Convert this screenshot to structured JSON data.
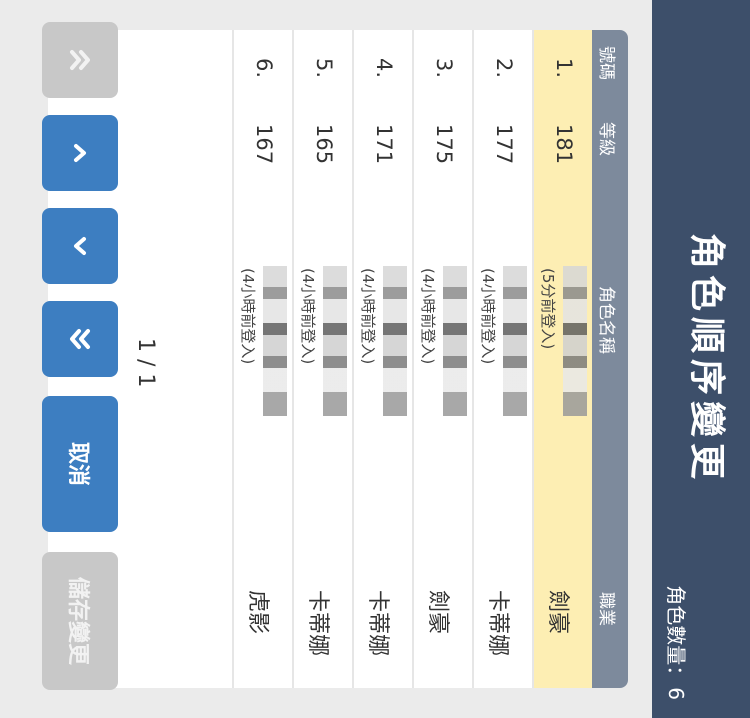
{
  "header": {
    "title": "角色順序變更",
    "count_label": "角色數量：",
    "count_value": "6"
  },
  "table": {
    "columns": {
      "no": "號碼",
      "level": "等級",
      "name": "角色名稱",
      "job": "職業"
    },
    "rows": [
      {
        "no": "1.",
        "level": "181",
        "login": "(5分前登入)",
        "job": "劍豪",
        "selected": true
      },
      {
        "no": "2.",
        "level": "177",
        "login": "(4小時前登入)",
        "job": "卡蒂娜",
        "selected": false
      },
      {
        "no": "3.",
        "level": "175",
        "login": "(4小時前登入)",
        "job": "劍豪",
        "selected": false
      },
      {
        "no": "4.",
        "level": "171",
        "login": "(4小時前登入)",
        "job": "卡蒂娜",
        "selected": false
      },
      {
        "no": "5.",
        "level": "165",
        "login": "(4小時前登入)",
        "job": "卡蒂娜",
        "selected": false
      },
      {
        "no": "6.",
        "level": "167",
        "login": "(4小時前登入)",
        "job": "虎影",
        "selected": false
      }
    ]
  },
  "footer": {
    "pager": "1 / 1",
    "cancel_label": "取消",
    "save_label": "儲存變更"
  },
  "icons": {
    "first": "double-chevron-up-icon",
    "up": "chevron-up-icon",
    "down": "chevron-down-icon",
    "last": "double-chevron-down-icon"
  },
  "colors": {
    "header": "#3d4f6a",
    "column_header": "#7d8a9c",
    "selected_row": "#fdeeb3",
    "button": "#3d7ec1",
    "disabled_button": "#c8c8c8"
  }
}
